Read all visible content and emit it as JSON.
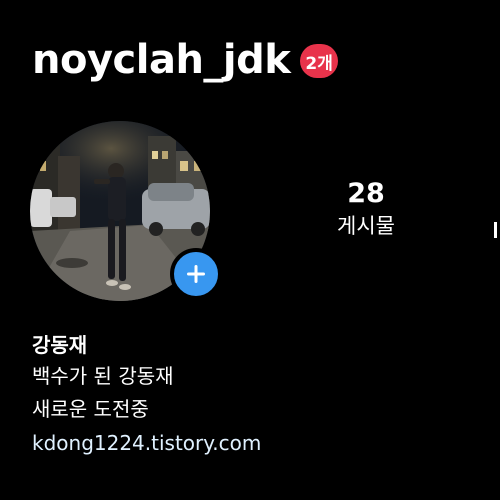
{
  "header": {
    "username": "noyclah_jdk",
    "badge": "2개"
  },
  "profile": {
    "avatar": "profile-photo",
    "add_icon": "plus-icon"
  },
  "stats": [
    {
      "value": "28",
      "label": "게시물"
    }
  ],
  "bio": {
    "name": "강동재",
    "lines": [
      "백수가 된 강동재",
      "새로운 도전중"
    ],
    "link": "kdong1224.tistory.com"
  },
  "colors": {
    "background": "#000000",
    "badge": "#e8334b",
    "add_button": "#3897f0",
    "link": "#e0f1ff"
  }
}
